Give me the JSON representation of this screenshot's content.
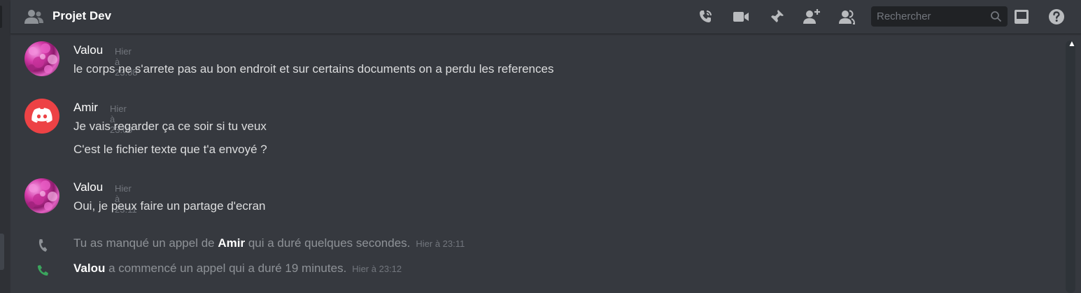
{
  "header": {
    "title": "Projet Dev",
    "search_placeholder": "Rechercher",
    "icons": [
      "call-icon",
      "video-icon",
      "pin-icon",
      "add-member-icon",
      "members-icon",
      "search-icon",
      "inbox-icon",
      "help-icon"
    ]
  },
  "messages": [
    {
      "author": "Valou",
      "timestamp": "Hier à 23:08",
      "lines": [
        "le corps ne s'arrete pas au bon endroit et sur certains documents on a perdu les references"
      ]
    },
    {
      "author": "Amir",
      "timestamp": "Hier à 23:09",
      "lines": [
        "Je vais regarder ça ce soir si tu veux",
        "C'est le fichier texte que t'a envoyé ?"
      ]
    },
    {
      "author": "Valou",
      "timestamp": "Hier à 23:11",
      "lines": [
        "Oui, je peux faire un partage d'ecran"
      ]
    }
  ],
  "system": [
    {
      "pre": "Tu as manqué un appel de ",
      "who": "Amir",
      "post": " qui a duré quelques secondes.",
      "timestamp": "Hier à 23:11",
      "icon": "missed-call-icon",
      "color": "#8e9297"
    },
    {
      "pre": "",
      "who": "Valou",
      "post": " a commencé un appel qui a duré 19 minutes.",
      "timestamp": "Hier à 23:12",
      "icon": "call-started-icon",
      "color": "#3ba55d"
    }
  ],
  "colors": {
    "background": "#36393f",
    "header": "#36393f",
    "discord_red": "#ed4245",
    "search_bg": "#202225"
  }
}
